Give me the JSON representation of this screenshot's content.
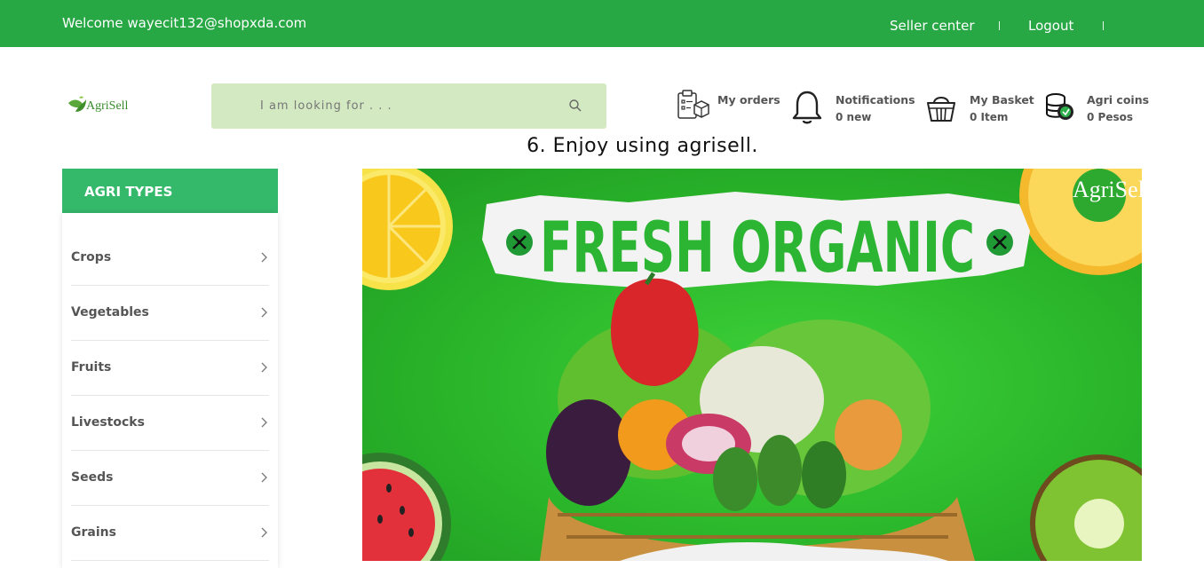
{
  "topbar": {
    "welcome": "Welcome wayecit132@shopxda.com",
    "seller_center": "Seller center",
    "logout": "Logout"
  },
  "header": {
    "logo_text": "AgriSell",
    "search_placeholder": "I am looking for . . .",
    "orders": {
      "label": "My orders",
      "icon": "clipboard-box-icon"
    },
    "notifications": {
      "label": "Notifications",
      "value": "0 new",
      "icon": "bell-icon"
    },
    "basket": {
      "label": "My Basket",
      "value": "0 Item",
      "icon": "basket-icon"
    },
    "coins": {
      "label": "Agri coins",
      "value": "0 Pesos",
      "icon": "coins-icon"
    }
  },
  "caption": "6. Enjoy using agrisell.",
  "sidebar": {
    "title": "AGRI TYPES",
    "items": [
      {
        "label": "Crops"
      },
      {
        "label": "Vegetables"
      },
      {
        "label": "Fruits"
      },
      {
        "label": "Livestocks"
      },
      {
        "label": "Seeds"
      },
      {
        "label": "Grains"
      }
    ]
  },
  "banner": {
    "headline": "FRESH ORGANIC",
    "brand": "AgriSell"
  },
  "colors": {
    "topbar": "#28a745",
    "sidebar_header": "#34b86a",
    "search_bg": "#d3e9c1",
    "banner_green": "#2ab52a"
  }
}
